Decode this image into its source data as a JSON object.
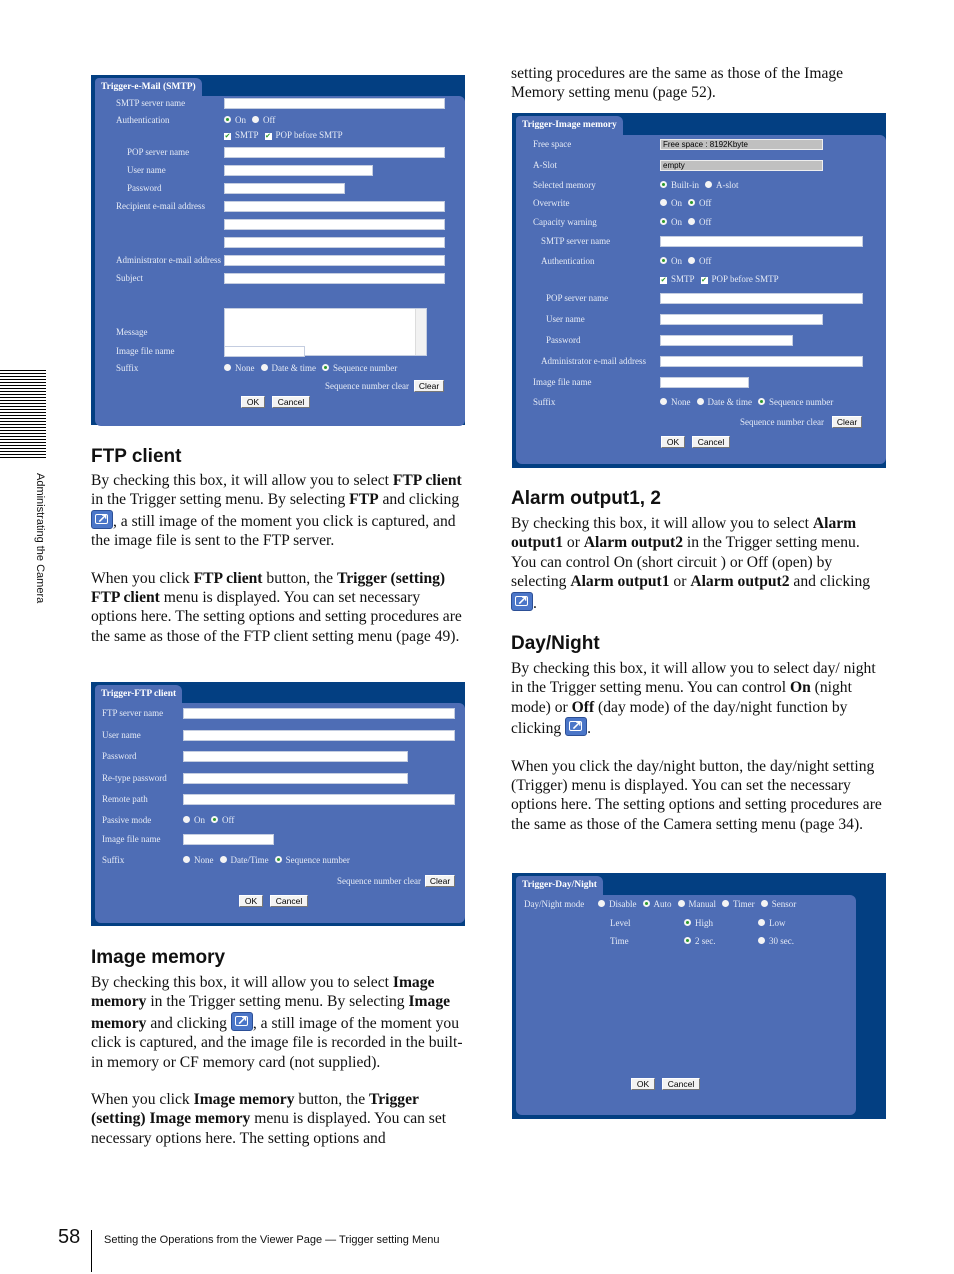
{
  "side_tab": {
    "label": "Administrating the Camera"
  },
  "footer": {
    "page_number": "58",
    "text": "Setting the Operations from the Viewer Page — Trigger setting Menu"
  },
  "colors": {
    "panel_border": "#033f82",
    "panel_body": "#4e6db5",
    "selected_radio": "#2b9a2b"
  },
  "icons": {
    "trigger_button": "trigger-capture-icon"
  },
  "left": {
    "ftp_heading": "FTP client",
    "ftp_paragraphs": [
      [
        "By checking this box, it will allow you to select ",
        {
          "b": "FTP client"
        },
        " in the Trigger setting menu. By selecting ",
        {
          "b": "FTP"
        },
        " and clicking ",
        {
          "icon": "trigger-capture-icon"
        },
        ", a still image of the moment you click is captured, and the image file is sent to the FTP server."
      ],
      [
        "When you click ",
        {
          "b": "FTP client"
        },
        " button, the ",
        {
          "b": "Trigger (setting) FTP client"
        },
        " menu is displayed. You can set necessary options here. The setting options and setting procedures are the same as those of the FTP client setting menu (page 49)."
      ]
    ],
    "image_memory_heading": "Image memory",
    "image_memory_paragraphs": [
      [
        "By checking this box, it will allow you to select ",
        {
          "b": "Image memory"
        },
        " in the Trigger setting menu. By selecting ",
        {
          "b": "Image memory"
        },
        " and clicking ",
        {
          "icon": "trigger-capture-icon"
        },
        ", a still image of the moment you click is captured, and the image file is recorded in the built-in memory or CF memory card (not supplied)."
      ],
      [
        "When you click ",
        {
          "b": "Image memory"
        },
        " button, the ",
        {
          "b": "Trigger (setting) Image memory"
        },
        " menu is displayed. You can set necessary options here. The setting options and"
      ]
    ]
  },
  "right": {
    "intro_paragraphs": [
      [
        "setting procedures are the same as those of the Image Memory setting menu (page 52)."
      ]
    ],
    "alarm_heading": "Alarm output1, 2",
    "alarm_paragraphs": [
      [
        "By checking this box, it will allow you to select ",
        {
          "b": "Alarm output1"
        },
        " or ",
        {
          "b": "Alarm output2"
        },
        " in the Trigger setting menu. You can control On (short circuit ) or Off (open) by selecting ",
        {
          "b": "Alarm output1"
        },
        " or ",
        {
          "b": "Alarm output2"
        },
        " and clicking ",
        {
          "icon": "trigger-capture-icon"
        },
        "."
      ]
    ],
    "daynight_heading": "Day/Night",
    "daynight_paragraphs": [
      [
        "By checking this box, it will allow you to select day/ night in the Trigger setting menu. You can control ",
        {
          "b": "On"
        },
        " (night mode) or ",
        {
          "b": "Off"
        },
        " (day mode) of the day/night function by clicking ",
        {
          "icon": "trigger-capture-icon"
        },
        "."
      ],
      [
        "When you click the day/night button, the day/night setting (Trigger) menu is displayed. You can set the necessary options here. The setting options and setting procedures are the same as those of the Camera setting menu (page 34)."
      ]
    ]
  },
  "panels": {
    "email": {
      "tab": "Trigger-e-Mail (SMTP)",
      "rows": [
        {
          "label": "SMTP server name",
          "type": "input",
          "value": ""
        },
        {
          "label": "Authentication",
          "type": "radio",
          "options": [
            "On",
            "Off"
          ],
          "selected": "On"
        },
        {
          "label": "",
          "type": "check",
          "options": [
            "SMTP",
            "POP before SMTP"
          ],
          "checked": [
            "SMTP",
            "POP before SMTP"
          ]
        },
        {
          "label": "POP server name",
          "type": "input",
          "value": ""
        },
        {
          "label": "User name",
          "type": "input",
          "value": ""
        },
        {
          "label": "Password",
          "type": "input",
          "value": ""
        },
        {
          "label": "Recipient e-mail address",
          "type": "input",
          "value": ""
        },
        {
          "label": "",
          "type": "input",
          "value": ""
        },
        {
          "label": "",
          "type": "input",
          "value": ""
        },
        {
          "label": "Administrator e-mail address",
          "type": "input",
          "value": ""
        },
        {
          "label": "Subject",
          "type": "input",
          "value": ""
        },
        {
          "label": "Message",
          "type": "textarea",
          "value": ""
        },
        {
          "label": "Image file name",
          "type": "input",
          "value": ""
        },
        {
          "label": "Suffix",
          "type": "radio",
          "options": [
            "None",
            "Date & time",
            "Sequence number"
          ],
          "selected": "Sequence number"
        },
        {
          "label": "Sequence number clear",
          "type": "clear",
          "button": "Clear"
        },
        {
          "label": "",
          "type": "buttons",
          "buttons": [
            "OK",
            "Cancel"
          ]
        }
      ]
    },
    "ftp": {
      "tab": "Trigger-FTP client",
      "rows": [
        {
          "label": "FTP server name",
          "type": "input",
          "value": ""
        },
        {
          "label": "User name",
          "type": "input",
          "value": ""
        },
        {
          "label": "Password",
          "type": "input",
          "value": ""
        },
        {
          "label": "Re-type password",
          "type": "input",
          "value": ""
        },
        {
          "label": "Remote path",
          "type": "input",
          "value": ""
        },
        {
          "label": "Passive mode",
          "type": "radio",
          "options": [
            "On",
            "Off"
          ],
          "selected": "Off"
        },
        {
          "label": "Image file name",
          "type": "input",
          "value": ""
        },
        {
          "label": "Suffix",
          "type": "radio",
          "options": [
            "None",
            "Date/Time",
            "Sequence number"
          ],
          "selected": "Sequence number"
        },
        {
          "label": "Sequence number clear",
          "type": "clear",
          "button": "Clear"
        },
        {
          "label": "",
          "type": "buttons",
          "buttons": [
            "OK",
            "Cancel"
          ]
        }
      ]
    },
    "image_memory": {
      "tab": "Trigger-Image memory",
      "rows": [
        {
          "label": "Free space",
          "type": "readonly",
          "value": "Free space : 8192Kbyte"
        },
        {
          "label": "A-Slot",
          "type": "readonly",
          "value": "empty"
        },
        {
          "label": "Selected memory",
          "type": "radio",
          "options": [
            "Built-in",
            "A-slot"
          ],
          "selected": "Built-in"
        },
        {
          "label": "Overwrite",
          "type": "radio",
          "options": [
            "On",
            "Off"
          ],
          "selected": "Off"
        },
        {
          "label": "Capacity warning",
          "type": "radio",
          "options": [
            "On",
            "Off"
          ],
          "selected": "On"
        },
        {
          "label": "SMTP server name",
          "type": "input",
          "value": ""
        },
        {
          "label": "Authentication",
          "type": "radio",
          "options": [
            "On",
            "Off"
          ],
          "selected": "On"
        },
        {
          "label": "",
          "type": "check",
          "options": [
            "SMTP",
            "POP before SMTP"
          ],
          "checked": [
            "SMTP",
            "POP before SMTP"
          ]
        },
        {
          "label": "POP server name",
          "type": "input",
          "value": ""
        },
        {
          "label": "User name",
          "type": "input",
          "value": ""
        },
        {
          "label": "Password",
          "type": "input",
          "value": ""
        },
        {
          "label": "Administrator e-mail address",
          "type": "input",
          "value": ""
        },
        {
          "label": "Image file name",
          "type": "input",
          "value": ""
        },
        {
          "label": "Suffix",
          "type": "radio",
          "options": [
            "None",
            "Date & time",
            "Sequence number"
          ],
          "selected": "Sequence number"
        },
        {
          "label": "Sequence number clear",
          "type": "clear",
          "button": "Clear"
        },
        {
          "label": "",
          "type": "buttons",
          "buttons": [
            "OK",
            "Cancel"
          ]
        }
      ]
    },
    "daynight": {
      "tab": "Trigger-Day/Night",
      "rows": [
        {
          "label": "Day/Night mode",
          "type": "radio",
          "options": [
            "Disable",
            "Auto",
            "Manual",
            "Timer",
            "Sensor"
          ],
          "selected": "Auto"
        },
        {
          "label": "Level",
          "type": "radio",
          "options": [
            "High",
            "Low"
          ],
          "selected": "High"
        },
        {
          "label": "Time",
          "type": "radio",
          "options": [
            "2 sec.",
            "30 sec."
          ],
          "selected": "2 sec."
        },
        {
          "label": "",
          "type": "buttons",
          "buttons": [
            "OK",
            "Cancel"
          ]
        }
      ]
    }
  }
}
